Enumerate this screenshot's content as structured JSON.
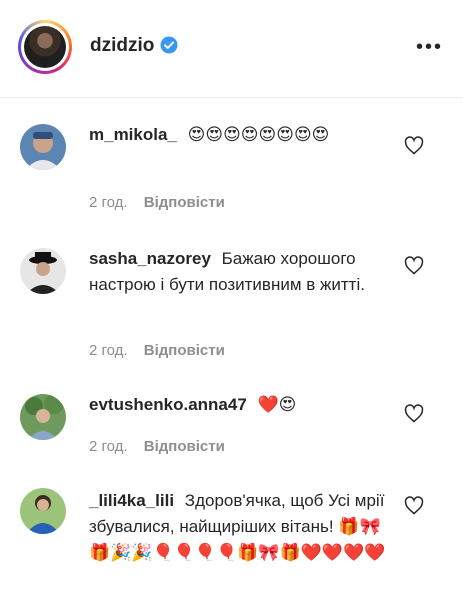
{
  "header": {
    "username": "dzidzio",
    "verified_icon": "verified-badge-icon",
    "more_icon": "more-dots-icon",
    "more_label": "•••"
  },
  "comments": [
    {
      "username": "m_mikola_",
      "text": "😍😍😍😍😍😍😍😍",
      "time": "2 год.",
      "reply": "Відповісти"
    },
    {
      "username": "sasha_nazorey",
      "text": "Бажаю хорошого настрою і бути позитивним в житті.",
      "time": "2 год.",
      "reply": "Відповісти"
    },
    {
      "username": "evtushenko.anna47",
      "text": "❤️😍",
      "time": "2 год.",
      "reply": "Відповісти"
    },
    {
      "username": "_lili4ka_lili",
      "text": "Здоров'ячка, щоб Усі мрії збувалися, найщиріших вітань! 🎁🎀🎁🎉🎉🎈🎈🎈🎈🎁🎀🎁❤️❤️❤️❤️"
    }
  ],
  "colors": {
    "text": "#262626",
    "muted": "#8e8e8e",
    "verified": "#3897f0"
  }
}
